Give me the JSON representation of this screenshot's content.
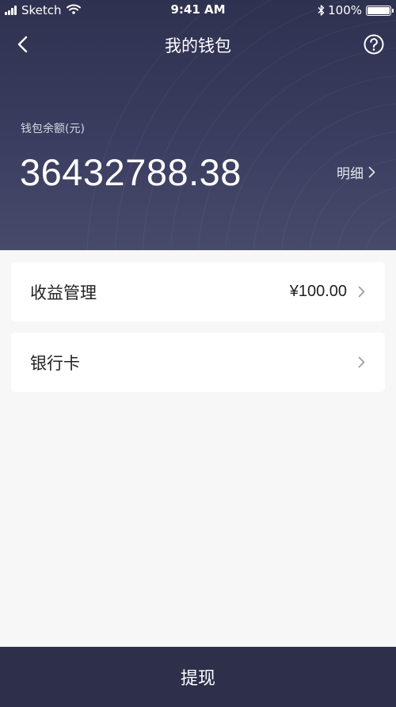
{
  "status_bar": {
    "carrier": "Sketch",
    "time": "9:41 AM",
    "battery": "100%"
  },
  "nav": {
    "title": "我的钱包"
  },
  "wallet": {
    "balance_label": "钱包余额(元)",
    "balance_amount": "36432788.38",
    "detail_label": "明细"
  },
  "items": {
    "earnings": {
      "label": "收益管理",
      "value": "¥100.00"
    },
    "bank_card": {
      "label": "银行卡"
    }
  },
  "actions": {
    "withdraw_label": "提现"
  },
  "colors": {
    "header_bg": "#363957",
    "button_bg": "#2d2f4b",
    "page_bg": "#f7f7f7"
  },
  "icons": {
    "back": "chevron-left-icon",
    "help": "question-circle-icon",
    "chevron": "chevron-right-icon",
    "signal": "signal-icon",
    "wifi": "wifi-icon",
    "bluetooth": "bluetooth-icon",
    "battery": "battery-icon"
  }
}
